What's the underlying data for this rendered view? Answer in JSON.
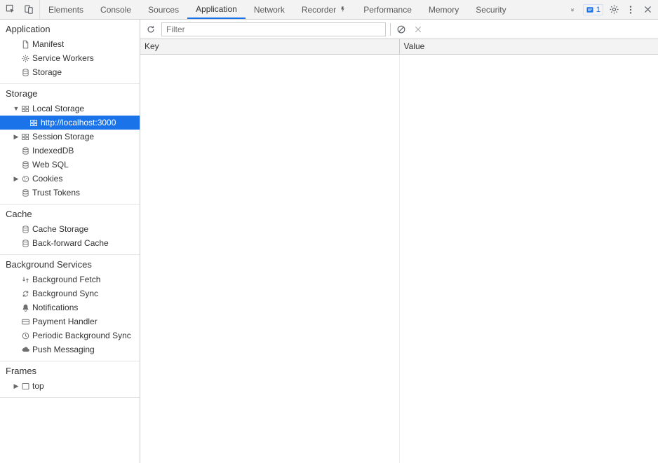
{
  "tabbar": {
    "tabs": [
      "Elements",
      "Console",
      "Sources",
      "Application",
      "Network",
      "Recorder",
      "Performance",
      "Memory",
      "Security"
    ],
    "active": "Application",
    "issues_count": "1"
  },
  "sidebar": {
    "sections": [
      {
        "title": "Application",
        "items": [
          {
            "icon": "file",
            "label": "Manifest",
            "depth": 1
          },
          {
            "icon": "gear",
            "label": "Service Workers",
            "depth": 1
          },
          {
            "icon": "db",
            "label": "Storage",
            "depth": 1
          }
        ]
      },
      {
        "title": "Storage",
        "items": [
          {
            "icon": "grid",
            "label": "Local Storage",
            "depth": 1,
            "arrow": "down"
          },
          {
            "icon": "grid",
            "label": "http://localhost:3000",
            "depth": 2,
            "selected": true
          },
          {
            "icon": "grid",
            "label": "Session Storage",
            "depth": 1,
            "arrow": "right"
          },
          {
            "icon": "db",
            "label": "IndexedDB",
            "depth": 1
          },
          {
            "icon": "db",
            "label": "Web SQL",
            "depth": 1
          },
          {
            "icon": "cookie",
            "label": "Cookies",
            "depth": 1,
            "arrow": "right"
          },
          {
            "icon": "db",
            "label": "Trust Tokens",
            "depth": 1
          }
        ]
      },
      {
        "title": "Cache",
        "items": [
          {
            "icon": "db",
            "label": "Cache Storage",
            "depth": 1
          },
          {
            "icon": "db",
            "label": "Back-forward Cache",
            "depth": 1
          }
        ]
      },
      {
        "title": "Background Services",
        "items": [
          {
            "icon": "fetch",
            "label": "Background Fetch",
            "depth": 1
          },
          {
            "icon": "sync",
            "label": "Background Sync",
            "depth": 1
          },
          {
            "icon": "bell",
            "label": "Notifications",
            "depth": 1
          },
          {
            "icon": "card",
            "label": "Payment Handler",
            "depth": 1
          },
          {
            "icon": "clock",
            "label": "Periodic Background Sync",
            "depth": 1
          },
          {
            "icon": "cloud",
            "label": "Push Messaging",
            "depth": 1
          }
        ]
      },
      {
        "title": "Frames",
        "items": [
          {
            "icon": "frame",
            "label": "top",
            "depth": 1,
            "arrow": "right"
          }
        ]
      }
    ]
  },
  "content": {
    "filter_placeholder": "Filter",
    "columns": [
      "Key",
      "Value"
    ]
  }
}
